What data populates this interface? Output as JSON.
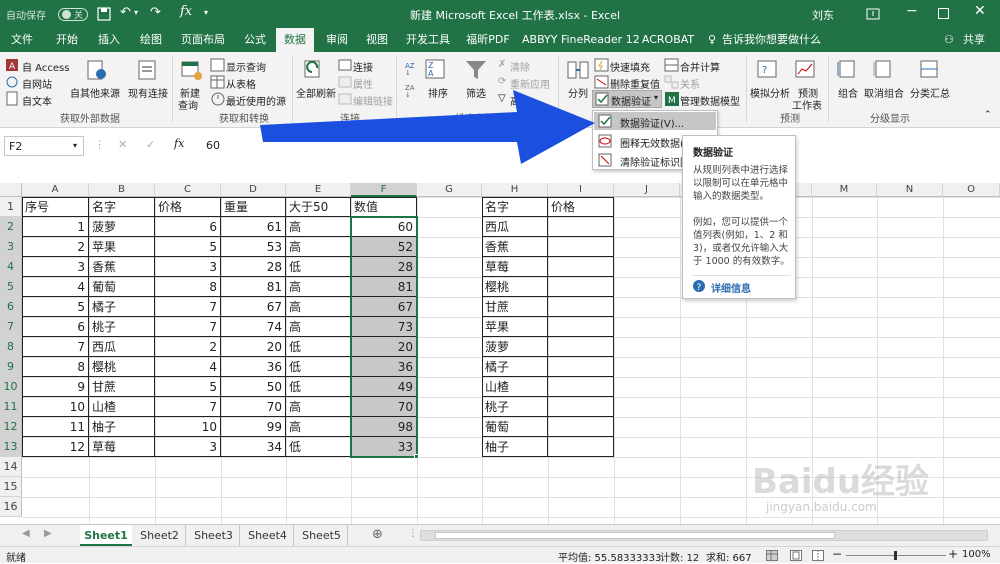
{
  "titlebar": {
    "autosave": "自动保存",
    "autosave_state": "关",
    "title": "新建 Microsoft Excel 工作表.xlsx - Excel",
    "user": "刘东"
  },
  "tabs": [
    "文件",
    "开始",
    "插入",
    "绘图",
    "页面布局",
    "公式",
    "数据",
    "审阅",
    "视图",
    "开发工具",
    "福昕PDF",
    "ABBYY FineReader 12",
    "ACROBAT"
  ],
  "active_tab": "数据",
  "tell_me": "告诉我你想要做什么",
  "share": "共享",
  "ribbon": {
    "get_external": {
      "access": "自 Access",
      "web": "自网站",
      "text": "自文本",
      "other": "自其他来源",
      "existing": "现有连接",
      "label": "获取外部数据"
    },
    "get_transform": {
      "new_query": "新建",
      "new_query2": "查询",
      "show_queries": "显示查询",
      "from_table": "从表格",
      "recent": "最近使用的源",
      "label": "获取和转换"
    },
    "connections": {
      "refresh_all": "全部刷新",
      "connections": "连接",
      "properties": "属性",
      "edit_links": "编辑链接",
      "label": "连接"
    },
    "sort_filter": {
      "sort": "排序",
      "filter": "筛选",
      "clear": "清除",
      "reapply": "重新应用",
      "advanced": "高级",
      "label": "排序和筛选"
    },
    "data_tools": {
      "text_to_columns": "分列",
      "flash_fill": "快速填充",
      "remove_dup": "删除重复值",
      "data_validation": "数据验证",
      "consolidate": "合并计算",
      "relationships": "关系",
      "manage_model": "管理数据模型"
    },
    "forecast": {
      "what_if": "模拟分析",
      "forecast_sheet": "预测",
      "forecast_sheet2": "工作表",
      "label": "预测"
    },
    "outline": {
      "group": "组合",
      "ungroup": "取消组合",
      "subtotal": "分类汇总",
      "label": "分级显示"
    }
  },
  "dropdown": {
    "items": [
      "数据验证(V)...",
      "圈释无效数据(I)",
      "清除验证标识圈(R)"
    ]
  },
  "tooltip": {
    "title": "数据验证",
    "p1": "从规则列表中进行选择以限制可以在单元格中输入的数据类型。",
    "p2": "例如，您可以提供一个值列表(例如，1、2 和 3)，或者仅允许输入大于 1000 的有效数字。",
    "link": "详细信息"
  },
  "formula_bar": {
    "name_box": "F2",
    "fx": "fx",
    "value": "60"
  },
  "columns": [
    "A",
    "B",
    "C",
    "D",
    "E",
    "F",
    "G",
    "H",
    "I",
    "J",
    "K",
    "L",
    "M",
    "N",
    "O"
  ],
  "rows": [
    "1",
    "2",
    "3",
    "4",
    "5",
    "6",
    "7",
    "8",
    "9",
    "10",
    "11",
    "12",
    "13",
    "14",
    "15",
    "16"
  ],
  "table1": {
    "headers": [
      "序号",
      "名字",
      "价格",
      "重量",
      "大于50",
      "数值"
    ],
    "rows": [
      [
        "1",
        "菠萝",
        "6",
        "61",
        "高",
        "60"
      ],
      [
        "2",
        "苹果",
        "5",
        "53",
        "高",
        "52"
      ],
      [
        "3",
        "香蕉",
        "3",
        "28",
        "低",
        "28"
      ],
      [
        "4",
        "葡萄",
        "8",
        "81",
        "高",
        "81"
      ],
      [
        "5",
        "橘子",
        "7",
        "67",
        "高",
        "67"
      ],
      [
        "6",
        "桃子",
        "7",
        "74",
        "高",
        "73"
      ],
      [
        "7",
        "西瓜",
        "2",
        "20",
        "低",
        "20"
      ],
      [
        "8",
        "樱桃",
        "4",
        "36",
        "低",
        "36"
      ],
      [
        "9",
        "甘蔗",
        "5",
        "50",
        "低",
        "49"
      ],
      [
        "10",
        "山楂",
        "7",
        "70",
        "高",
        "70"
      ],
      [
        "11",
        "柚子",
        "10",
        "99",
        "高",
        "98"
      ],
      [
        "12",
        "草莓",
        "3",
        "34",
        "低",
        "33"
      ]
    ]
  },
  "table2": {
    "headers": [
      "名字",
      "价格"
    ],
    "names": [
      "西瓜",
      "香蕉",
      "草莓",
      "樱桃",
      "甘蔗",
      "苹果",
      "菠萝",
      "橘子",
      "山楂",
      "桃子",
      "葡萄",
      "柚子"
    ]
  },
  "sheets": [
    "Sheet1",
    "Sheet2",
    "Sheet3",
    "Sheet4",
    "Sheet5"
  ],
  "active_sheet": "Sheet1",
  "status": {
    "mode": "就绪",
    "average": "平均值: 55.58333333",
    "count": "计数: 12",
    "sum": "求和: 667",
    "zoom": "100%"
  },
  "watermark": "Baidu经验",
  "watermark_url": "jingyan.baidu.com",
  "colors": {
    "excel_green": "#217346",
    "arrow_blue": "#1a4fe0",
    "selection_gray": "#c8c8c8"
  }
}
